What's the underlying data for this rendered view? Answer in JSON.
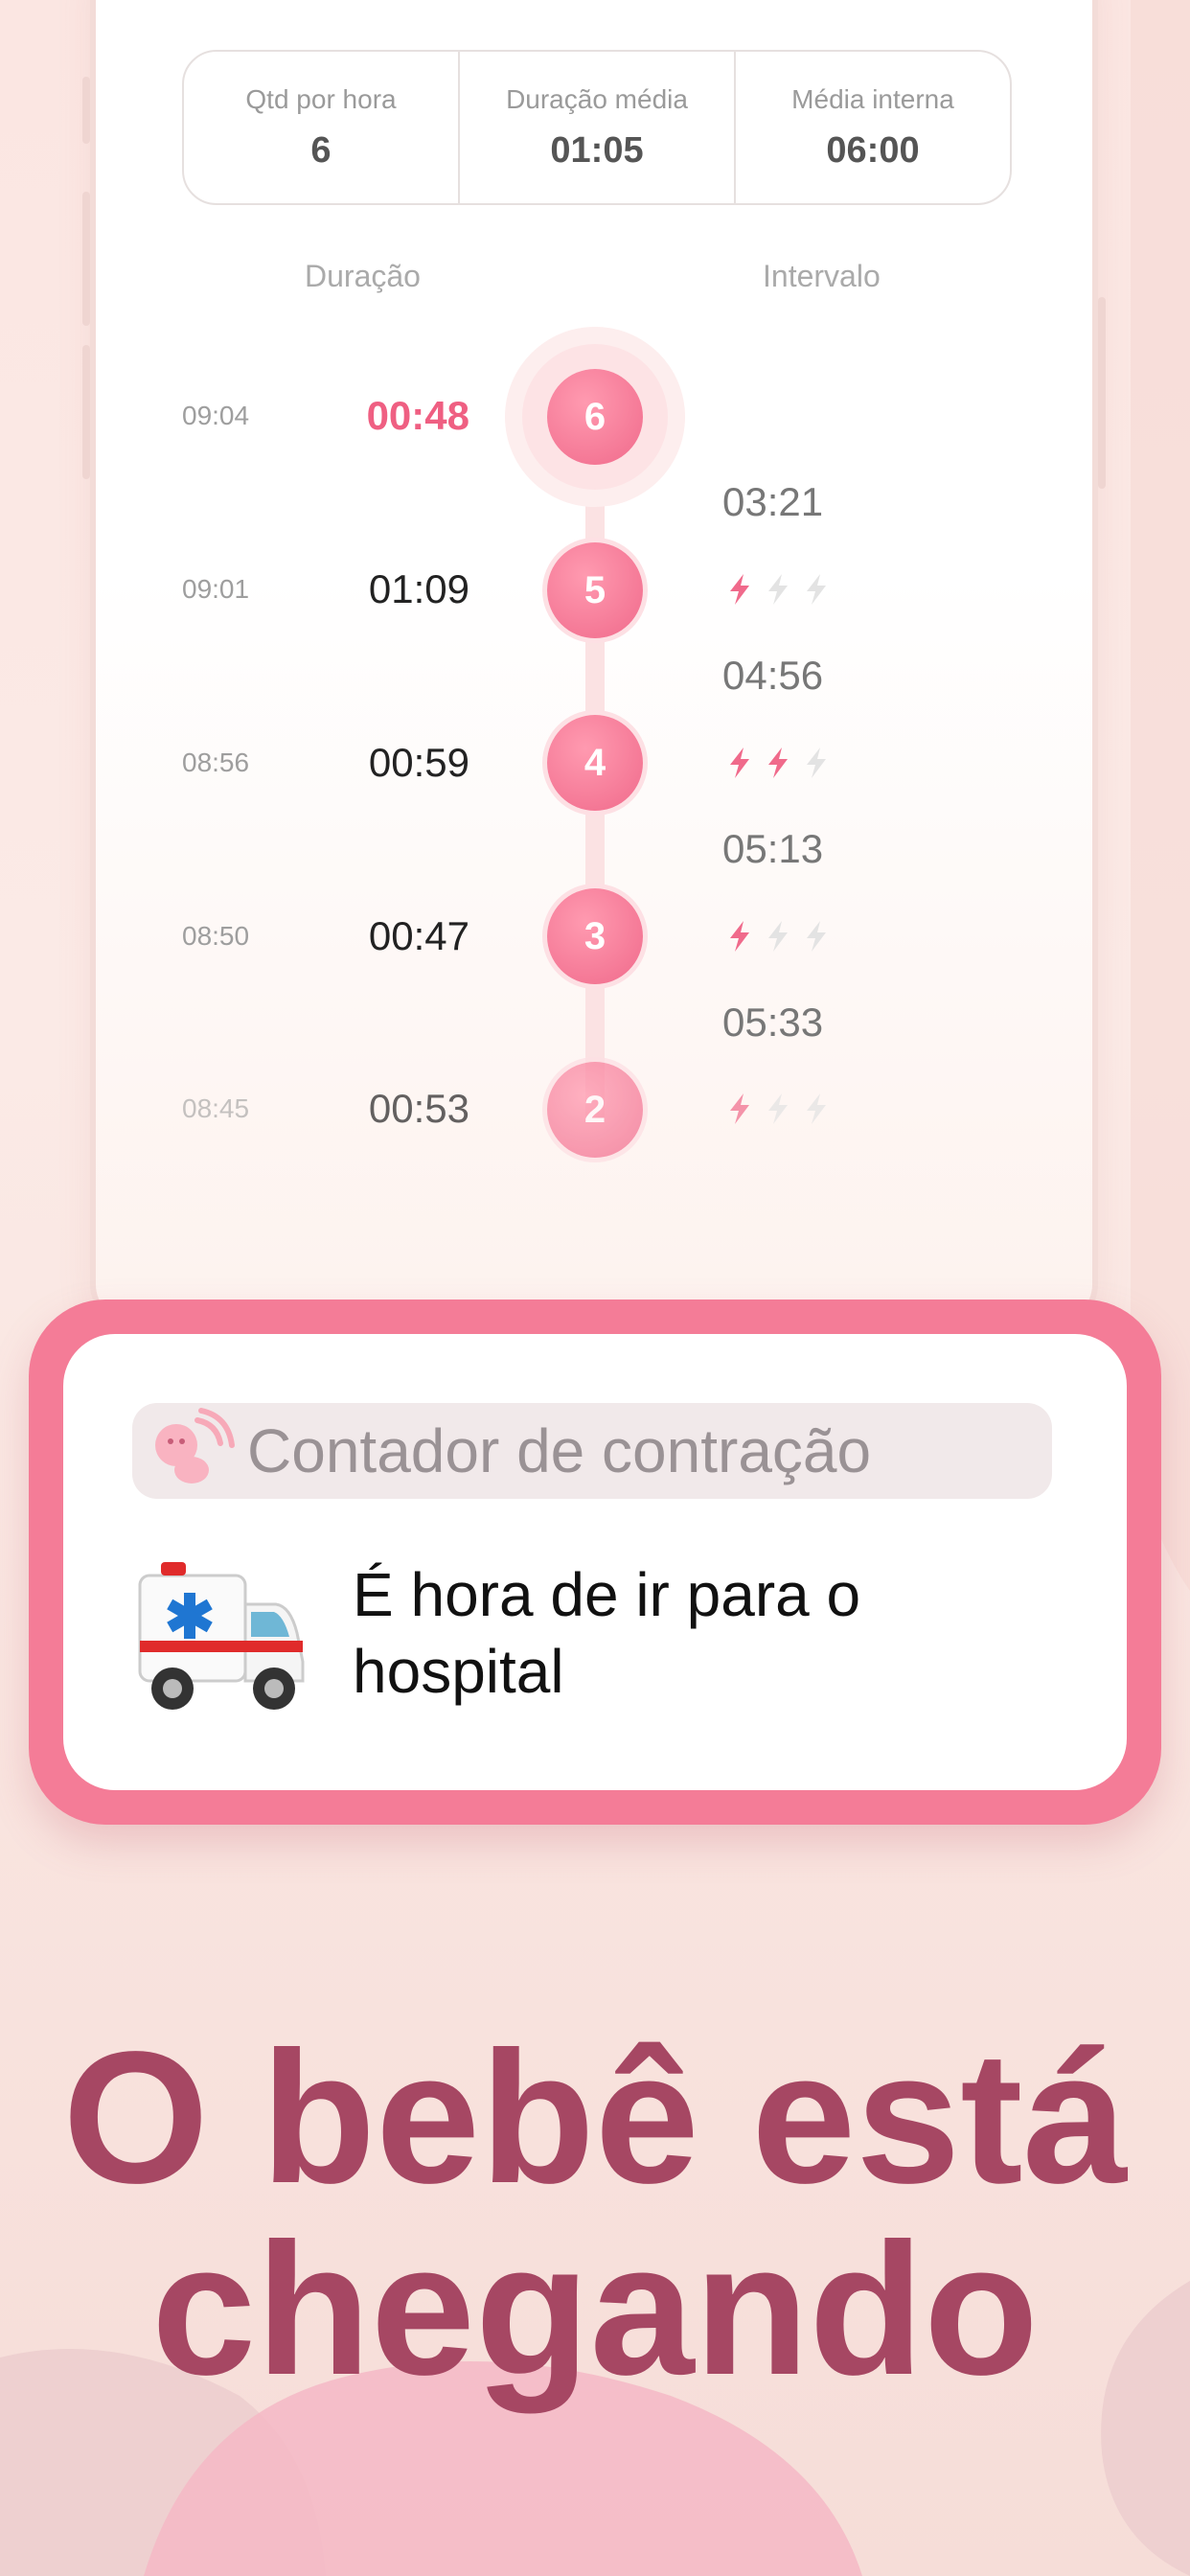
{
  "stats": [
    {
      "label": "Qtd por hora",
      "value": "6"
    },
    {
      "label": "Duração média",
      "value": "01:05"
    },
    {
      "label": "Média interna",
      "value": "06:00"
    }
  ],
  "columns": {
    "duration": "Duração",
    "interval": "Intervalo"
  },
  "contractions": [
    {
      "number": "6",
      "time": "09:04",
      "duration": "00:48",
      "highlight": true
    },
    {
      "number": "5",
      "time": "09:01",
      "duration": "01:09",
      "intensity": 1
    },
    {
      "number": "4",
      "time": "08:56",
      "duration": "00:59",
      "intensity": 2
    },
    {
      "number": "3",
      "time": "08:50",
      "duration": "00:47",
      "intensity": 1
    },
    {
      "number": "2",
      "time": "08:45",
      "duration": "00:53",
      "intensity": 1
    }
  ],
  "intervals": [
    "03:21",
    "04:56",
    "05:13",
    "05:33"
  ],
  "intensity_max": 3,
  "notification": {
    "app_name": "Contador de contração",
    "message": "É hora de ir para o hospital",
    "icon": "ambulance-icon",
    "app_icon": "baby-icon"
  },
  "headline": {
    "line1": "O bebê está",
    "line2": "chegando"
  },
  "colors": {
    "accent": "#f06a8b",
    "headline": "#a64763",
    "card_border": "#f47c97",
    "bolt_active": "#f06a8b",
    "bolt_inactive": "#e3e3e3"
  }
}
